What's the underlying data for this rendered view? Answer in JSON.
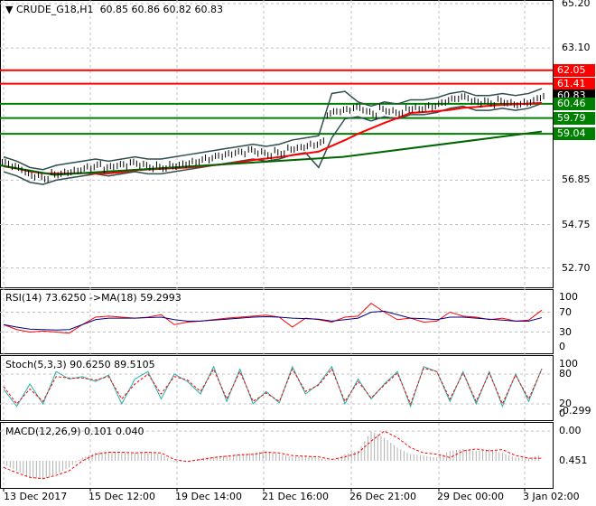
{
  "header": {
    "symbol": "CRUDE_G18,H1",
    "ohlc": "60.85 60.86 60.82 60.83"
  },
  "price_axis": [
    "65.20",
    "63.10",
    "56.85",
    "54.75",
    "52.70"
  ],
  "levels": [
    {
      "label": "62.05",
      "value": 62.05,
      "color": "#ff0000"
    },
    {
      "label": "61.41",
      "value": 61.41,
      "color": "#ff0000"
    },
    {
      "label": "60.83",
      "value": 60.83,
      "color": "#000000"
    },
    {
      "label": "60.46",
      "value": 60.46,
      "color": "#008000"
    },
    {
      "label": "59.79",
      "value": 59.79,
      "color": "#008000"
    },
    {
      "label": "59.04",
      "value": 59.04,
      "color": "#008000"
    }
  ],
  "rsi": {
    "title": "RSI(14) 73.6250  ->MA(18) 59.2993",
    "axis": [
      "100",
      "70",
      "30",
      "0"
    ]
  },
  "stoch": {
    "title": "Stoch(5,3,3) 90.6250 89.5105",
    "axis": [
      "100",
      "80",
      "20",
      "0"
    ]
  },
  "macd": {
    "title": "MACD(12,26,9) 0.101 0.040",
    "axis": [
      "0.451",
      "0.00",
      "-0.299"
    ]
  },
  "time_axis": [
    "13 Dec 2017",
    "15 Dec 12:00",
    "19 Dec 14:00",
    "21 Dec 16:00",
    "26 Dec 21:00",
    "29 Dec 00:00",
    "3 Jan 02:00"
  ],
  "chart_data": {
    "type": "line",
    "close": [
      57.6,
      57.4,
      57.1,
      57.0,
      57.2,
      57.3,
      57.4,
      57.5,
      57.4,
      57.5,
      57.6,
      57.5,
      57.5,
      57.6,
      57.7,
      57.8,
      57.9,
      58.0,
      58.1,
      58.2,
      58.1,
      58.2,
      58.4,
      58.5,
      58.6,
      60.0,
      60.1,
      60.2,
      60.0,
      60.2,
      60.1,
      60.3,
      60.3,
      60.4,
      60.6,
      60.7,
      60.5,
      60.5,
      60.6,
      60.5,
      60.6,
      60.83
    ],
    "rsi": [
      45,
      35,
      30,
      32,
      30,
      28,
      45,
      60,
      62,
      60,
      58,
      60,
      65,
      45,
      50,
      52,
      55,
      58,
      60,
      62,
      64,
      60,
      40,
      58,
      55,
      50,
      60,
      62,
      88,
      70,
      55,
      58,
      50,
      52,
      70,
      62,
      60,
      55,
      58,
      52,
      54,
      74
    ],
    "rsi_ma": [
      45,
      40,
      36,
      35,
      34,
      35,
      45,
      55,
      58,
      58,
      58,
      59,
      60,
      55,
      52,
      52,
      54,
      56,
      58,
      60,
      61,
      60,
      58,
      57,
      56,
      52,
      55,
      58,
      70,
      72,
      65,
      58,
      57,
      55,
      60,
      60,
      58,
      56,
      54,
      52,
      52,
      59
    ],
    "stoch_k": [
      50,
      15,
      60,
      20,
      85,
      70,
      75,
      65,
      78,
      20,
      70,
      85,
      30,
      80,
      65,
      40,
      95,
      25,
      90,
      20,
      45,
      22,
      95,
      40,
      60,
      95,
      20,
      70,
      30,
      60,
      85,
      15,
      95,
      85,
      25,
      85,
      20,
      85,
      15,
      80,
      25,
      91
    ],
    "stoch_d": [
      55,
      20,
      50,
      25,
      75,
      72,
      72,
      68,
      75,
      30,
      60,
      80,
      40,
      75,
      68,
      45,
      90,
      30,
      85,
      25,
      42,
      25,
      90,
      45,
      58,
      90,
      25,
      65,
      32,
      58,
      82,
      20,
      92,
      85,
      30,
      82,
      25,
      82,
      20,
      78,
      30,
      90
    ],
    "macd_hist": [
      -0.05,
      -0.15,
      -0.25,
      -0.28,
      -0.2,
      -0.1,
      0.05,
      0.12,
      0.14,
      0.13,
      0.12,
      0.14,
      0.1,
      -0.02,
      0.0,
      0.03,
      0.06,
      0.08,
      0.1,
      0.12,
      0.15,
      0.1,
      0.06,
      0.08,
      0.04,
      0.0,
      0.1,
      0.15,
      0.45,
      0.35,
      0.2,
      0.1,
      0.08,
      0.05,
      0.15,
      0.18,
      0.15,
      0.18,
      0.12,
      0.05,
      0.04,
      0.1
    ],
    "macd_signal": [
      -0.1,
      -0.18,
      -0.25,
      -0.27,
      -0.22,
      -0.15,
      0.0,
      0.1,
      0.13,
      0.13,
      0.12,
      0.13,
      0.12,
      0.02,
      -0.01,
      0.02,
      0.05,
      0.07,
      0.09,
      0.1,
      0.13,
      0.12,
      0.08,
      0.07,
      0.06,
      0.02,
      0.06,
      0.12,
      0.3,
      0.45,
      0.35,
      0.2,
      0.12,
      0.1,
      0.05,
      0.15,
      0.18,
      0.15,
      0.17,
      0.08,
      0.04,
      0.04
    ]
  }
}
